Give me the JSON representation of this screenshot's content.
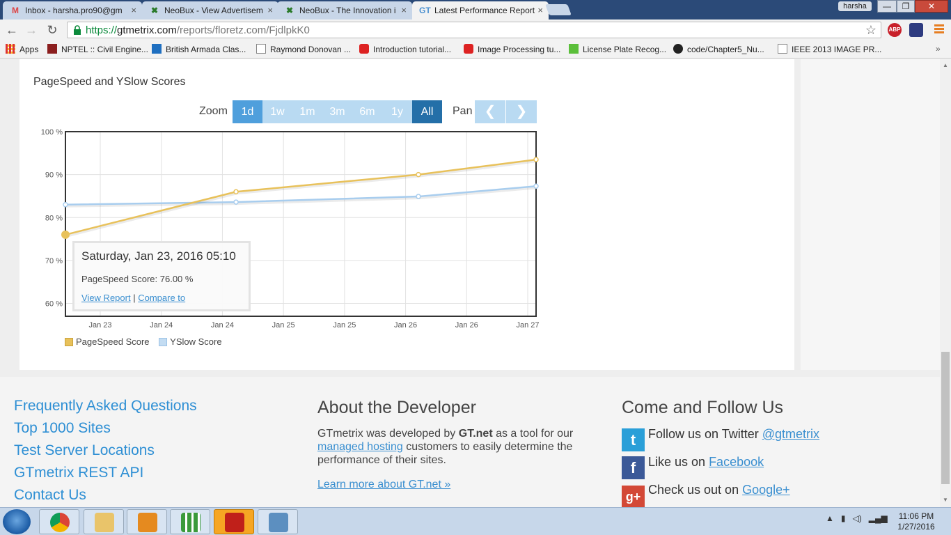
{
  "browser": {
    "tabs": [
      {
        "title": "Inbox - harsha.pro90@gm",
        "favicon": "gmail-icon"
      },
      {
        "title": "NeoBux - View Advertisem",
        "favicon": "neobux-icon"
      },
      {
        "title": "NeoBux - The Innovation i",
        "favicon": "neobux-icon"
      },
      {
        "title": "Latest Performance Report",
        "favicon": "gtmetrix-icon"
      }
    ],
    "user": "harsha",
    "window_buttons": {
      "minimize": "—",
      "maximize": "❐",
      "close": "✕"
    },
    "url": {
      "scheme": "https://",
      "host": "gtmetrix.com",
      "path": "/reports/floretz.com/FjdlpkK0"
    },
    "bookmarks": [
      {
        "label": "Apps",
        "icon": "apps-grid-icon"
      },
      {
        "label": "NPTEL :: Civil Engine...",
        "icon": "nptel-icon"
      },
      {
        "label": "British Armada Clas...",
        "icon": "bookmark-site-icon"
      },
      {
        "label": "Raymond Donovan ...",
        "icon": "page-icon"
      },
      {
        "label": "Introduction tutorial...",
        "icon": "youtube-icon"
      },
      {
        "label": "Image Processing tu...",
        "icon": "youtube-icon"
      },
      {
        "label": "License Plate Recog...",
        "icon": "bookmark-site-icon"
      },
      {
        "label": "code/Chapter5_Nu...",
        "icon": "github-icon"
      },
      {
        "label": "IEEE 2013 IMAGE PR...",
        "icon": "page-icon"
      }
    ]
  },
  "page": {
    "chart_title": "PageSpeed and YSlow Scores",
    "zoom_label": "Zoom",
    "zoom_buttons": [
      "1d",
      "1w",
      "1m",
      "3m",
      "6m",
      "1y",
      "All"
    ],
    "pan_label": "Pan",
    "tooltip": {
      "date": "Saturday, Jan 23, 2016 05:10",
      "score": "PageSpeed Score: 76.00 %",
      "view_report": "View Report",
      "separator": "|",
      "compare": "Compare to"
    },
    "legend": [
      "PageSpeed Score",
      "YSlow Score"
    ]
  },
  "chart_data": {
    "type": "line",
    "title": "PageSpeed and YSlow Scores",
    "y_ticks": [
      "100 %",
      "90 %",
      "80 %",
      "70 %",
      "60 %"
    ],
    "x_ticks": [
      "Jan 23",
      "Jan 24",
      "Jan 24",
      "Jan 25",
      "Jan 25",
      "Jan 26",
      "Jan 26",
      "Jan 27"
    ],
    "ylim": [
      57,
      100
    ],
    "grid": true,
    "legend_position": "bottom-left",
    "series": [
      {
        "name": "PageSpeed Score",
        "color": "#e8c15a",
        "points": [
          {
            "x": 0.0,
            "y": 76
          },
          {
            "x": 1.45,
            "y": 86
          },
          {
            "x": 3.0,
            "y": 90
          },
          {
            "x": 4.0,
            "y": 93.5
          }
        ]
      },
      {
        "name": "YSlow Score",
        "color": "#a8cdee",
        "points": [
          {
            "x": 0.0,
            "y": 83
          },
          {
            "x": 1.45,
            "y": 83.6
          },
          {
            "x": 3.0,
            "y": 84.9
          },
          {
            "x": 4.0,
            "y": 87.3
          }
        ]
      }
    ],
    "x_domain": [
      0,
      4
    ]
  },
  "footer": {
    "links": [
      "Frequently Asked Questions",
      "Top 1000 Sites",
      "Test Server Locations",
      "GTmetrix REST API",
      "Contact Us"
    ],
    "developer": {
      "heading": "About the Developer",
      "text_1": "GTmetrix was developed by ",
      "bold": "GT.net",
      "text_2": " as a tool for our ",
      "link": "managed hosting",
      "text_3": " customers to easily determine the performance of their sites.",
      "more": "Learn more about GT.net »"
    },
    "follow": {
      "heading": "Come and Follow Us",
      "items": [
        {
          "text": "Follow us on Twitter ",
          "link": "@gtmetrix",
          "icon": "twitter-icon",
          "color": "#2a9fd8"
        },
        {
          "text": "Like us on ",
          "link": "Facebook",
          "icon": "facebook-icon",
          "color": "#3b5998"
        },
        {
          "text": "Check us out on ",
          "link": "Google+",
          "icon": "google-plus-icon",
          "color": "#d34836"
        }
      ]
    }
  },
  "taskbar": {
    "time": "11:06 PM",
    "date": "1/27/2016"
  }
}
